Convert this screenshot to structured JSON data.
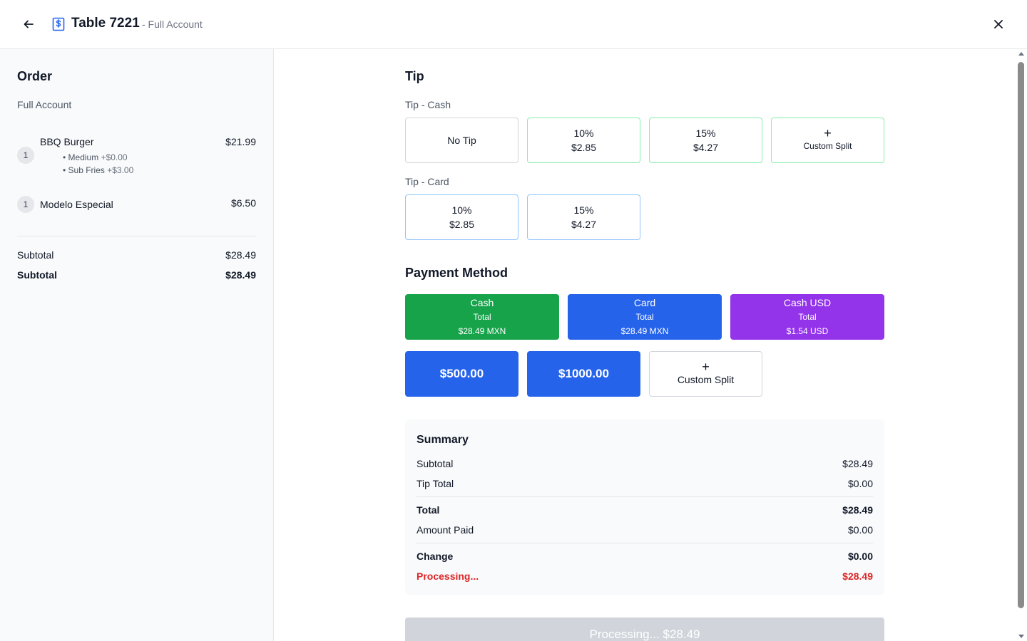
{
  "header": {
    "title": "Table 7221",
    "subtitle": "- Full Account",
    "icon": "receipt-dollar-icon"
  },
  "sidebar": {
    "title": "Order",
    "account": "Full Account",
    "items": [
      {
        "qty": "1",
        "name": "BBQ Burger",
        "price": "$21.99",
        "modifiers": [
          {
            "name": "• Medium",
            "price": "+$0.00"
          },
          {
            "name": "• Sub Fries",
            "price": "+$3.00"
          }
        ]
      },
      {
        "qty": "1",
        "name": "Modelo Especial",
        "price": "$6.50",
        "modifiers": []
      }
    ],
    "totals": [
      {
        "label": "Subtotal",
        "value": "$28.49"
      },
      {
        "label": "Subtotal",
        "value": "$28.49"
      }
    ]
  },
  "tip": {
    "title": "Tip",
    "cash_label": "Tip - Cash",
    "cash_options": [
      {
        "line1": "No Tip",
        "line2": ""
      },
      {
        "line1": "10%",
        "line2": "$2.85"
      },
      {
        "line1": "15%",
        "line2": "$4.27"
      },
      {
        "line1": "+",
        "line2": "Custom Split"
      }
    ],
    "card_label": "Tip - Card",
    "card_options": [
      {
        "line1": "10%",
        "line2": "$2.85"
      },
      {
        "line1": "15%",
        "line2": "$4.27"
      }
    ]
  },
  "payment": {
    "title": "Payment Method",
    "methods": [
      {
        "name": "Cash",
        "total_label": "Total",
        "amount": "$28.49 MXN",
        "color": "#16a34a"
      },
      {
        "name": "Card",
        "total_label": "Total",
        "amount": "$28.49 MXN",
        "color": "#2563eb"
      },
      {
        "name": "Cash USD",
        "total_label": "Total",
        "amount": "$1.54 USD",
        "color": "#9333ea"
      }
    ],
    "quick_amounts": [
      "$500.00",
      "$1000.00"
    ],
    "custom_split": {
      "icon": "+",
      "label": "Custom Split"
    }
  },
  "summary": {
    "title": "Summary",
    "subtotal_label": "Subtotal",
    "subtotal": "$28.49",
    "tip_label": "Tip Total",
    "tip": "$0.00",
    "total_label": "Total",
    "total": "$28.49",
    "paid_label": "Amount Paid",
    "paid": "$0.00",
    "change_label": "Change",
    "change": "$0.00",
    "status_label": "Processing...",
    "status_value": "$28.49"
  },
  "process_button": "Processing... $28.49"
}
